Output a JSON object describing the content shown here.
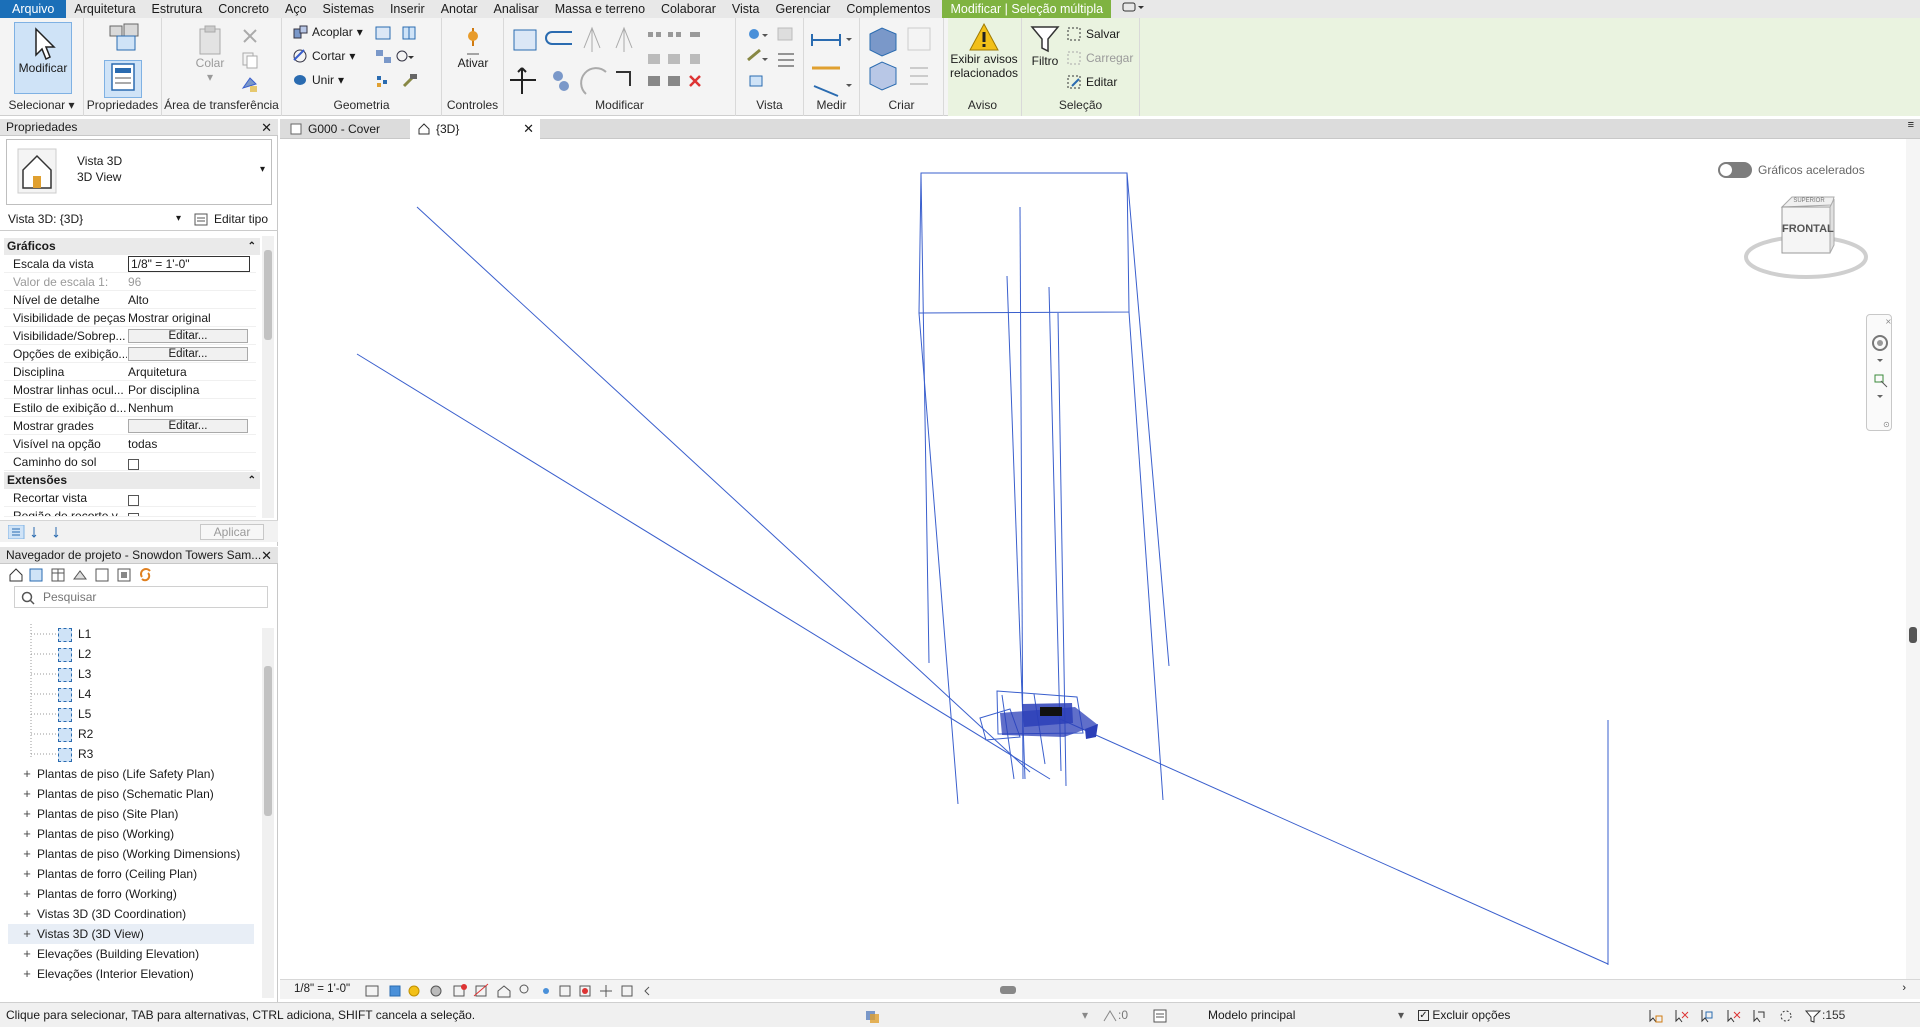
{
  "menu": {
    "items": [
      "Arquivo",
      "Arquitetura",
      "Estrutura",
      "Concreto",
      "Aço",
      "Sistemas",
      "Inserir",
      "Anotar",
      "Analisar",
      "Massa e terreno",
      "Colaborar",
      "Vista",
      "Gerenciar",
      "Complementos"
    ],
    "context_tab": "Modificar | Seleção múltipla"
  },
  "ribbon": {
    "modify_label": "Modificar",
    "select_group": "Selecionar",
    "properties_group": "Propriedades",
    "clipboard_group": "Área de transferência",
    "paste_label": "Colar",
    "geometry_group": "Geometria",
    "join_cope": "Acoplar",
    "cut": "Cortar",
    "join": "Unir",
    "controls_group": "Controles",
    "activate": "Ativar",
    "modify_group": "Modificar",
    "view_group": "Vista",
    "measure_group": "Medir",
    "create_group": "Criar",
    "warning_btn_line1": "Exibir avisos",
    "warning_btn_line2": "relacionados",
    "warning_group": "Aviso",
    "filter": "Filtro",
    "save": "Salvar",
    "load": "Carregar",
    "edit": "Editar",
    "selection_group": "Seleção"
  },
  "properties": {
    "title": "Propriedades",
    "type_name": "Vista 3D",
    "type_sub": "3D View",
    "instance_selector": "Vista 3D: {3D}",
    "edit_type": "Editar tipo",
    "sections": [
      {
        "name": "Gráficos",
        "rows": [
          {
            "k": "Escala da vista",
            "v": "1/8\" = 1'-0\""
          },
          {
            "k": "Valor de escala    1:",
            "v": "96"
          },
          {
            "k": "Nível de detalhe",
            "v": "Alto"
          },
          {
            "k": "Visibilidade de peças",
            "v": "Mostrar original"
          },
          {
            "k": "Visibilidade/Sobrep...",
            "v": "Editar..."
          },
          {
            "k": "Opções de exibição...",
            "v": "Editar..."
          },
          {
            "k": "Disciplina",
            "v": "Arquitetura"
          },
          {
            "k": "Mostrar linhas ocul...",
            "v": "Por disciplina"
          },
          {
            "k": "Estilo de exibição d...",
            "v": "Nenhum"
          },
          {
            "k": "Mostrar grades",
            "v": "Editar..."
          },
          {
            "k": "Visível na opção",
            "v": "todas"
          },
          {
            "k": "Caminho do sol",
            "v": ""
          }
        ]
      },
      {
        "name": "Extensões",
        "rows": [
          {
            "k": "Recortar vista",
            "v": ""
          },
          {
            "k": "Região de recorte v...",
            "v": ""
          }
        ]
      }
    ],
    "apply": "Aplicar"
  },
  "navigator": {
    "title": "Navegador de projeto - Snowdon Towers Sam...",
    "search_placeholder": "Pesquisar",
    "levels": [
      "L1",
      "L2",
      "L3",
      "L4",
      "L5",
      "R2",
      "R3"
    ],
    "groups": [
      "Plantas de piso (Life Safety Plan)",
      "Plantas de piso (Schematic Plan)",
      "Plantas de piso (Site Plan)",
      "Plantas de piso (Working)",
      "Plantas de piso (Working Dimensions)",
      "Plantas de forro (Ceiling Plan)",
      "Plantas de forro (Working)",
      "Vistas 3D (3D Coordination)",
      "Vistas 3D (3D View)",
      "Elevações (Building Elevation)",
      "Elevações (Interior Elevation)"
    ]
  },
  "tabs": {
    "items": [
      {
        "label": "G000 - Cover"
      },
      {
        "label": "{3D}"
      }
    ]
  },
  "viewport": {
    "accelerated": "Gráficos acelerados",
    "viewcube_face": "FRONTAL",
    "viewcube_top": "SUPERIOR"
  },
  "viewbar": {
    "scale": "1/8\" = 1'-0\""
  },
  "status": {
    "hint": "Clique para selecionar, TAB para alternativas, CTRL adiciona, SHIFT cancela a seleção.",
    "workset_count": ":0",
    "model": "Modelo principal",
    "exclude_options": "Excluir opções",
    "filter_count": ":155"
  },
  "colors": {
    "accent": "#1b6fb8",
    "context": "#7fb341",
    "model_lines": "#3a5fcd"
  }
}
